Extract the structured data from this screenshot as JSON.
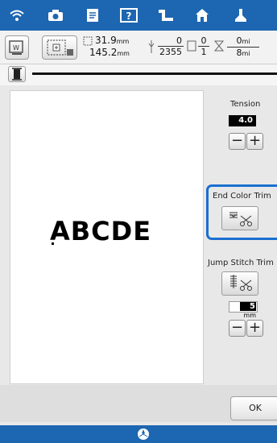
{
  "topbar": {
    "icons": [
      "wifi-icon",
      "camera-icon",
      "document-icon",
      "help-icon",
      "embroidery-frame-icon",
      "home-icon",
      "presser-foot-icon"
    ]
  },
  "infobar": {
    "width_value": "31.9",
    "height_value": "145.2",
    "unit": "mm",
    "stitch_num": "0",
    "stitch_den": "2355",
    "color_num": "0",
    "color_den": "1",
    "time_num": "0",
    "time_den": "8",
    "time_unit": "mi"
  },
  "preview": {
    "text": "ABCDE"
  },
  "tension": {
    "label": "Tension",
    "value": "4.0"
  },
  "end_color_trim": {
    "label": "End Color Trim"
  },
  "jump_stitch_trim": {
    "label": "Jump Stitch Trim",
    "value": "5",
    "unit": "mm"
  },
  "actions": {
    "ok_label": "OK"
  },
  "colors": {
    "accent": "#1d66b1",
    "highlight": "#1a6fd0"
  }
}
